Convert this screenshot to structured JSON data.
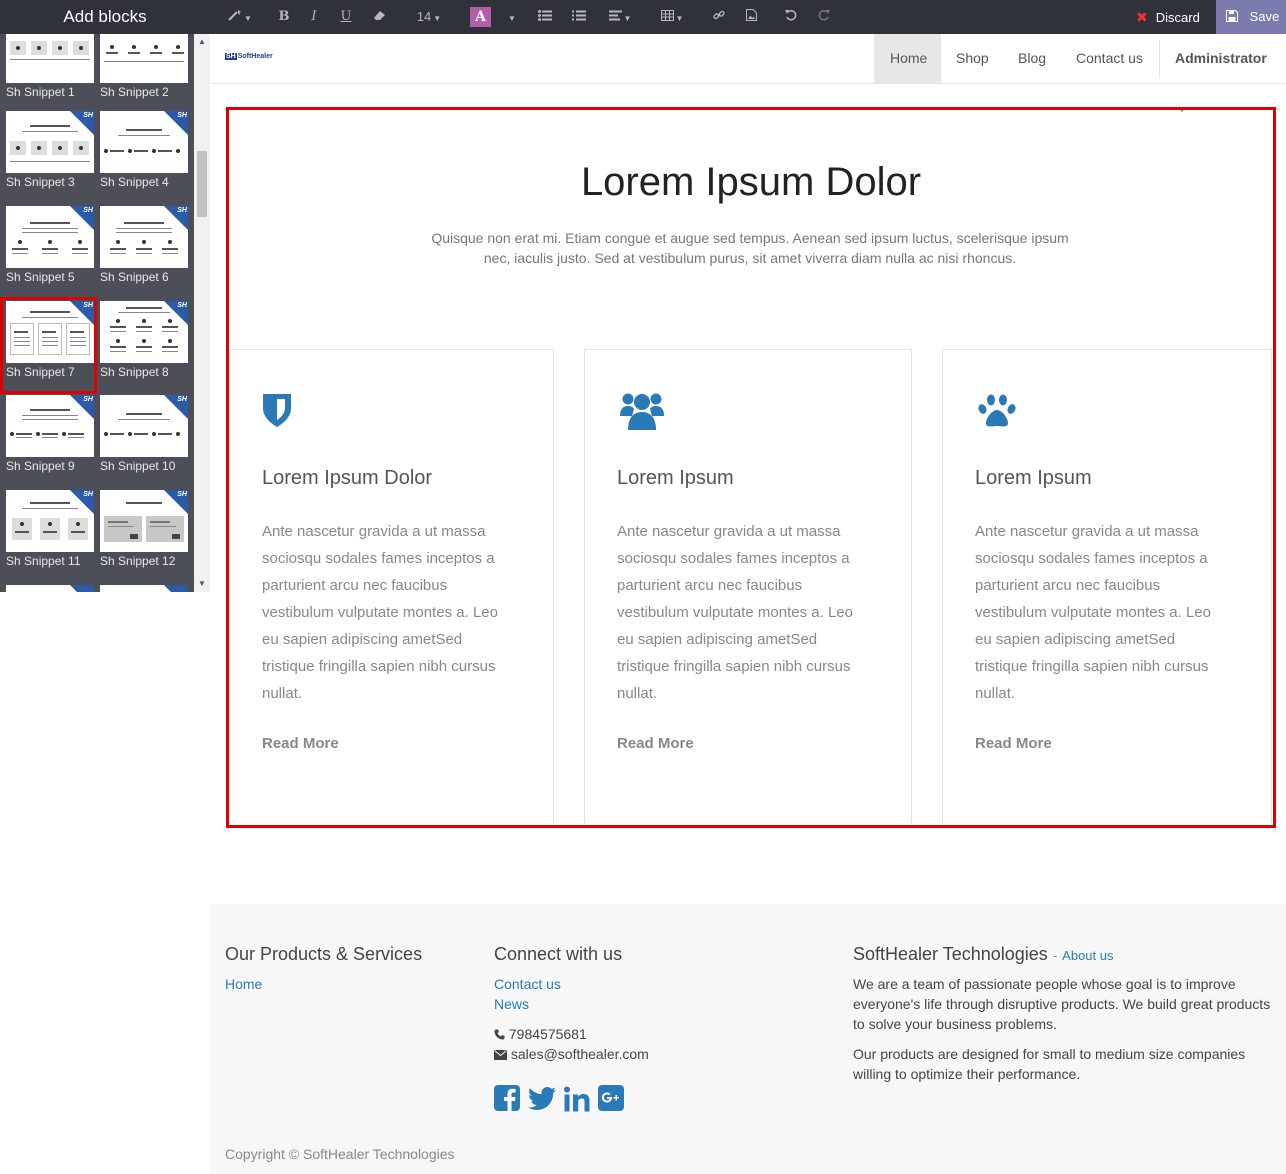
{
  "sidebar": {
    "title": "Add blocks",
    "snippets": [
      {
        "label": "Sh Snippet 1"
      },
      {
        "label": "Sh Snippet 2"
      },
      {
        "label": "Sh Snippet 3"
      },
      {
        "label": "Sh Snippet 4"
      },
      {
        "label": "Sh Snippet 5"
      },
      {
        "label": "Sh Snippet 6"
      },
      {
        "label": "Sh Snippet 7"
      },
      {
        "label": "Sh Snippet 8"
      },
      {
        "label": "Sh Snippet 9"
      },
      {
        "label": "Sh Snippet 10"
      },
      {
        "label": "Sh Snippet 11"
      },
      {
        "label": "Sh Snippet 12"
      }
    ],
    "selected_snippet": "Sh Snippet 7",
    "ribbon_text": "SH"
  },
  "toolbar": {
    "font_size": "14",
    "color_letter": "A",
    "discard_label": "Discard",
    "save_label": "Save",
    "bold": "B",
    "italic": "I",
    "underline": "U"
  },
  "site": {
    "logo_mark": "SH",
    "logo_text": "SoftHealer",
    "nav": {
      "home": "Home",
      "shop": "Shop",
      "blog": "Blog",
      "contact": "Contact us",
      "admin": "Administrator"
    },
    "active_nav": "Home"
  },
  "section": {
    "title": "Lorem Ipsum Dolor",
    "subtitle": "Quisque non erat mi. Etiam congue et augue sed tempus. Aenean sed ipsum luctus, scelerisque ipsum nec, iaculis justo. Sed at vestibulum purus, sit amet viverra diam nulla ac nisi rhoncus.",
    "features": [
      {
        "icon": "shield-icon",
        "title": "Lorem Ipsum Dolor",
        "text": "Ante nascetur gravida a ut massa sociosqu sodales fames inceptos a parturient arcu nec faucibus vestibulum vulputate montes a. Leo eu sapien adipiscing ametSed tristique fringilla sapien nibh cursus nullat.",
        "link": "Read More"
      },
      {
        "icon": "users-icon",
        "title": "Lorem Ipsum",
        "text": "Ante nascetur gravida a ut massa sociosqu sodales fames inceptos a parturient arcu nec faucibus vestibulum vulputate montes a. Leo eu sapien adipiscing ametSed tristique fringilla sapien nibh cursus nullat.",
        "link": "Read More"
      },
      {
        "icon": "paw-icon",
        "title": "Lorem Ipsum",
        "text": "Ante nascetur gravida a ut massa sociosqu sodales fames inceptos a parturient arcu nec faucibus vestibulum vulputate montes a. Leo eu sapien adipiscing ametSed tristique fringilla sapien nibh cursus nullat.",
        "link": "Read More"
      }
    ],
    "icon_color": "#2a7ab8"
  },
  "footer": {
    "products_title": "Our Products & Services",
    "products_home": "Home",
    "connect_title": "Connect with us",
    "contact_link": "Contact us",
    "news_link": "News",
    "phone": "7984575681",
    "email": "sales@softhealer.com",
    "company_title": "SoftHealer Technologies",
    "about_dash": "-",
    "about_link": "About us",
    "about_p1": "We are a team of passionate people whose goal is to improve everyone's life through disruptive products. We build great products to solve your business problems.",
    "about_p2": "Our products are designed for small to medium size companies willing to optimize their performance.",
    "copyright": "Copyright © SoftHealer Technologies",
    "social": [
      "facebook-icon",
      "twitter-icon",
      "linkedin-icon",
      "google-plus-icon"
    ],
    "link_color": "#2a7ab8"
  }
}
